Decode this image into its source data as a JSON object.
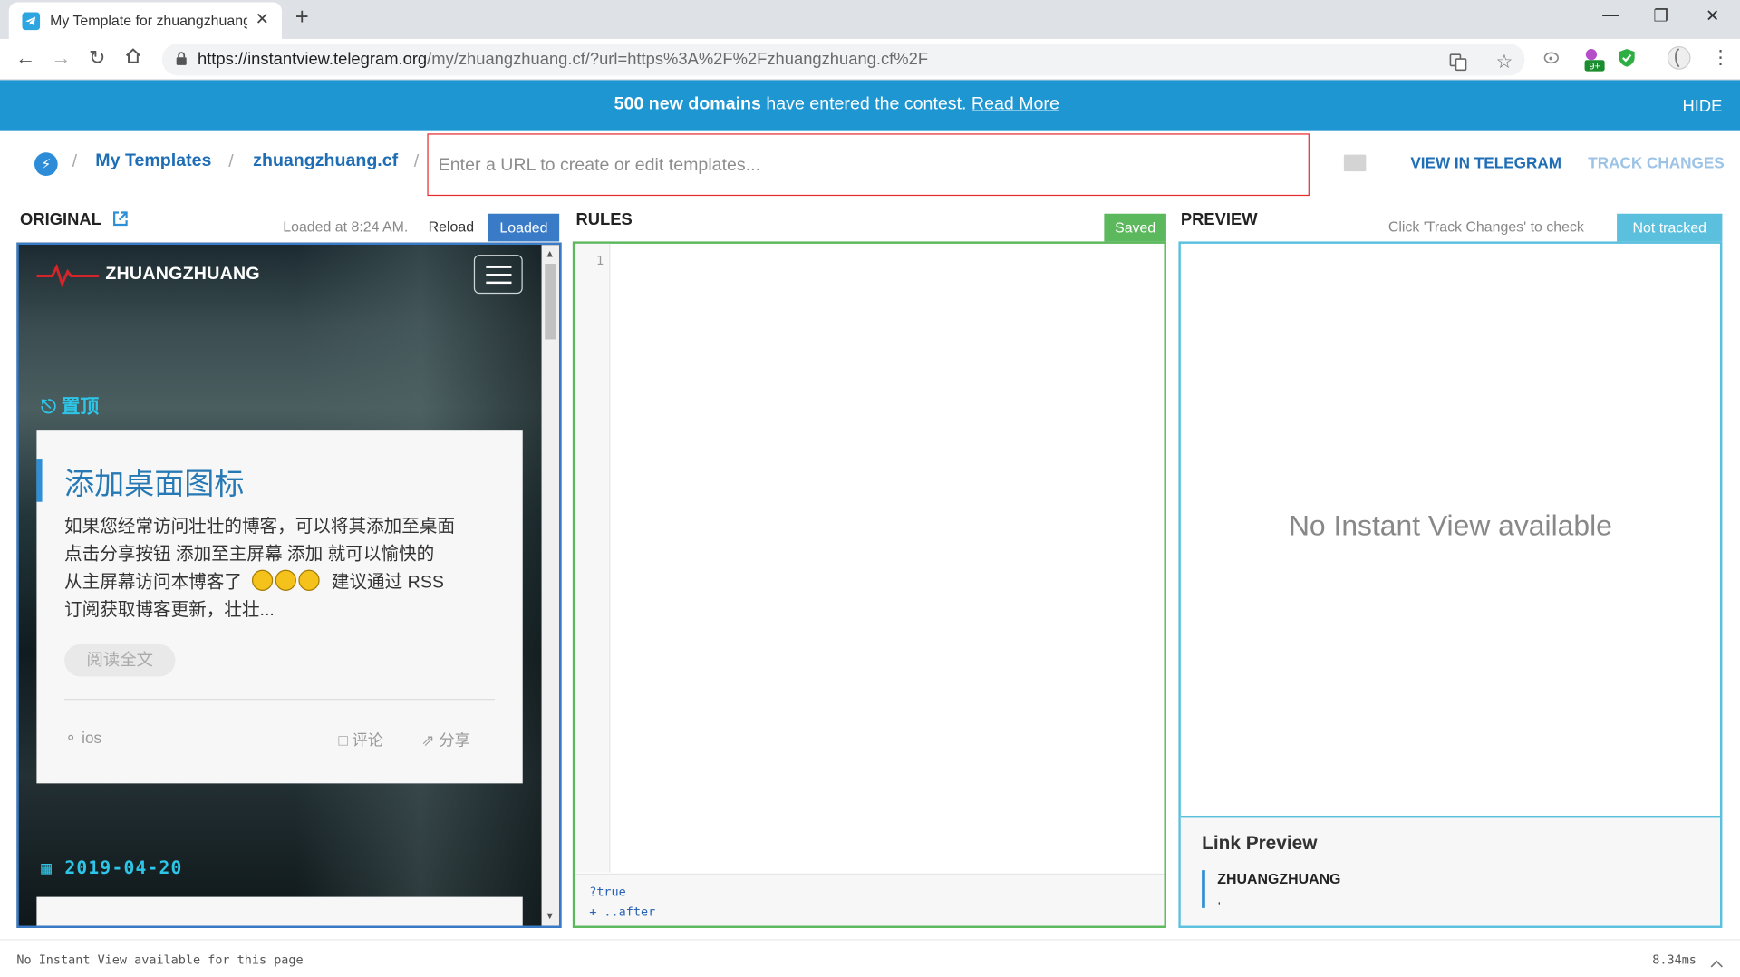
{
  "browser": {
    "tab_title": "My Template for zhuangzhuang.cf",
    "tab_close": "✕",
    "new_tab": "+",
    "url_host": "https://instantview.telegram.org",
    "url_path": "/my/zhuangzhuang.cf/?url=https%3A%2F%2Fzhuangzhuang.cf%2F",
    "window_minimize": "—",
    "window_restore": "❐",
    "window_close": "✕",
    "ext_badge": "9+"
  },
  "banner": {
    "bold": "500 new domains",
    "text": " have entered the contest. ",
    "link": "Read More",
    "hide": "HIDE"
  },
  "header": {
    "crumb_my_templates": "My Templates",
    "crumb_domain": "zhuangzhuang.cf",
    "url_placeholder": "Enter a URL to create or edit templates...",
    "view_in_telegram": "VIEW IN TELEGRAM",
    "track_changes": "TRACK CHANGES"
  },
  "original": {
    "title": "ORIGINAL",
    "loaded_at": "Loaded at 8:24 AM.",
    "reload": "Reload",
    "status": "Loaded",
    "site_name": "ZHUANGZHUANG",
    "pinned_label": "置顶",
    "post_title": "添加桌面图标",
    "post_body_1": "如果您经常访问壮壮的博客，可以将其添加至桌面",
    "post_body_2": "点击分享按钮 添加至主屏幕 添加 就可以愉快的",
    "post_body_3a": "从主屏幕访问本博客了",
    "post_body_3b": "建议通过 RSS",
    "post_body_4": "订阅获取博客更新，壮壮...",
    "read_more": "阅读全文",
    "tag": "ios",
    "comment": "评论",
    "share": "分享",
    "date": "2019-04-20"
  },
  "rules": {
    "title": "RULES",
    "status": "Saved",
    "line_number": "1",
    "footer_line_1": "?true",
    "footer_line_2": "+ ..after"
  },
  "preview": {
    "title": "PREVIEW",
    "hint": "Click 'Track Changes' to check",
    "status": "Not tracked",
    "empty_message": "No Instant View available",
    "link_preview_title": "Link Preview",
    "link_preview_site": "ZHUANGZHUANG",
    "link_preview_desc": ","
  },
  "status_bar": {
    "message": "No Instant View available for this page",
    "timing": "8.34ms"
  },
  "colors": {
    "banner": "#1e96d2",
    "link": "#1e6db5",
    "original_border": "#3a7bc8",
    "rules_border": "#5cb85c",
    "preview_border": "#5bc0de",
    "url_box_border": "#e52b2b"
  }
}
